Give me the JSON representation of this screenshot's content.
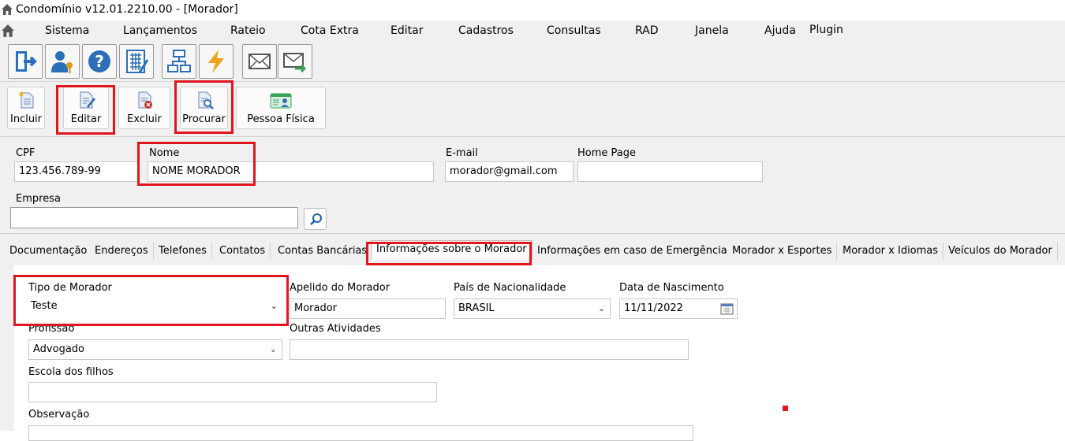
{
  "window": {
    "title": "Condomínio v12.01.2210.00 - [Morador]"
  },
  "menu": [
    "Sistema",
    "Lançamentos",
    "Rateio",
    "Cota Extra",
    "Editar",
    "Cadastros",
    "Consultas",
    "RAD",
    "Janela",
    "Ajuda",
    "Plugin"
  ],
  "toolbar": {
    "icons": [
      "exit-icon",
      "user-key-icon",
      "help-icon",
      "calculator-icon",
      "org-chart-icon",
      "lightning-icon",
      "mail-icon",
      "mail-send-icon"
    ]
  },
  "actions": {
    "incluir": "Incluir",
    "editar": "Editar",
    "excluir": "Excluir",
    "procurar": "Procurar",
    "pessoa_fisica": "Pessoa Física"
  },
  "person": {
    "cpf_label": "CPF",
    "cpf_value": "123.456.789-99",
    "nome_label": "Nome",
    "nome_value": "NOME MORADOR",
    "email_label": "E-mail",
    "email_value": "morador@gmail.com",
    "homepage_label": "Home Page",
    "homepage_value": "",
    "empresa_label": "Empresa",
    "empresa_value": ""
  },
  "tabs": [
    "Documentação",
    "Endereços",
    "Telefones",
    "Contatos",
    "Contas Bancárias",
    "Informações sobre o Morador",
    "Informações em caso de Emergência",
    "Morador x Esportes",
    "Morador x Idiomas",
    "Veículos do Morador"
  ],
  "active_tab": "Informações sobre o Morador",
  "morador": {
    "tipo_label": "Tipo de Morador",
    "tipo_value": "Teste",
    "apelido_label": "Apelido do  Morador",
    "apelido_value": "Morador",
    "pais_label": "País de Nacionalidade",
    "pais_value": "BRASIL",
    "nascimento_label": "Data de Nascimento",
    "nascimento_value": "11/11/2022",
    "profissao_label": "Profissão",
    "profissao_value": "Advogado",
    "outras_label": "Outras Atividades",
    "outras_value": "",
    "escola_label": "Escola dos filhos",
    "escola_value": "",
    "obs_label": "Observação"
  },
  "colors": {
    "highlight": "#e0161e",
    "window_bg": "#f0f0f0"
  }
}
